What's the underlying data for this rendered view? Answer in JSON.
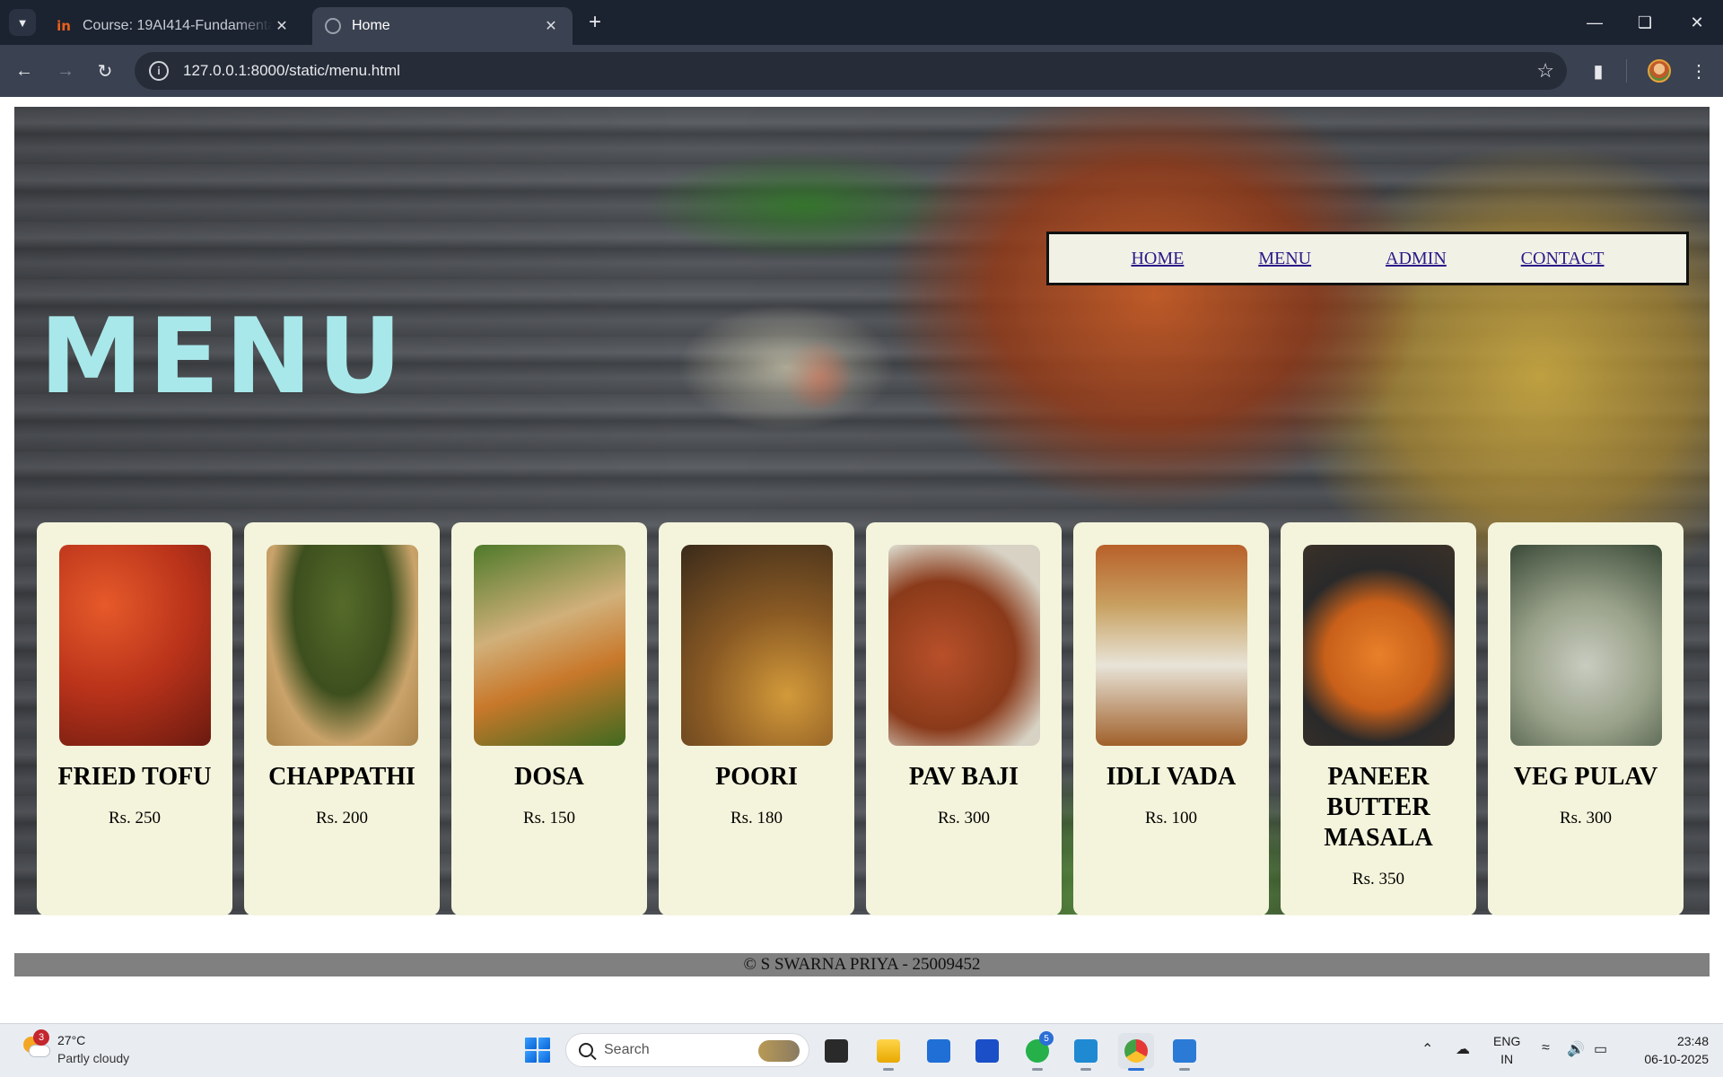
{
  "browser": {
    "tabs": [
      {
        "title": "Course: 19AI414-Fundamentals",
        "favicon": "in-icon",
        "active": false
      },
      {
        "title": "Home",
        "favicon": "globe-icon",
        "active": true
      }
    ],
    "url": "127.0.0.1:8000/static/menu.html"
  },
  "page": {
    "nav": [
      "HOME",
      "MENU",
      "ADMIN",
      "CONTACT"
    ],
    "title": "MENU",
    "items": [
      {
        "name": "FRIED TOFU",
        "price": "Rs. 250"
      },
      {
        "name": "CHAPPATHI",
        "price": "Rs. 200"
      },
      {
        "name": "DOSA",
        "price": "Rs. 150"
      },
      {
        "name": "POORI",
        "price": "Rs. 180"
      },
      {
        "name": "PAV BAJI",
        "price": "Rs. 300"
      },
      {
        "name": "IDLI VADA",
        "price": "Rs. 100"
      },
      {
        "name": "PANEER BUTTER MASALA",
        "price": "Rs. 350"
      },
      {
        "name": "VEG PULAV",
        "price": "Rs. 300"
      }
    ],
    "footer": "© S SWARNA PRIYA - 25009452",
    "colors": {
      "title": "#a8e8ea",
      "card_bg": "#f4f4dc",
      "nav_bg": "#f1f1e6",
      "footer_bg": "#808080"
    }
  },
  "taskbar": {
    "weather": {
      "badge": "3",
      "temp": "27°C",
      "desc": "Partly cloudy"
    },
    "search_placeholder": "Search",
    "whatsapp_badge": "5",
    "lang_line1": "ENG",
    "lang_line2": "IN",
    "time": "23:48",
    "date": "06-10-2025"
  }
}
